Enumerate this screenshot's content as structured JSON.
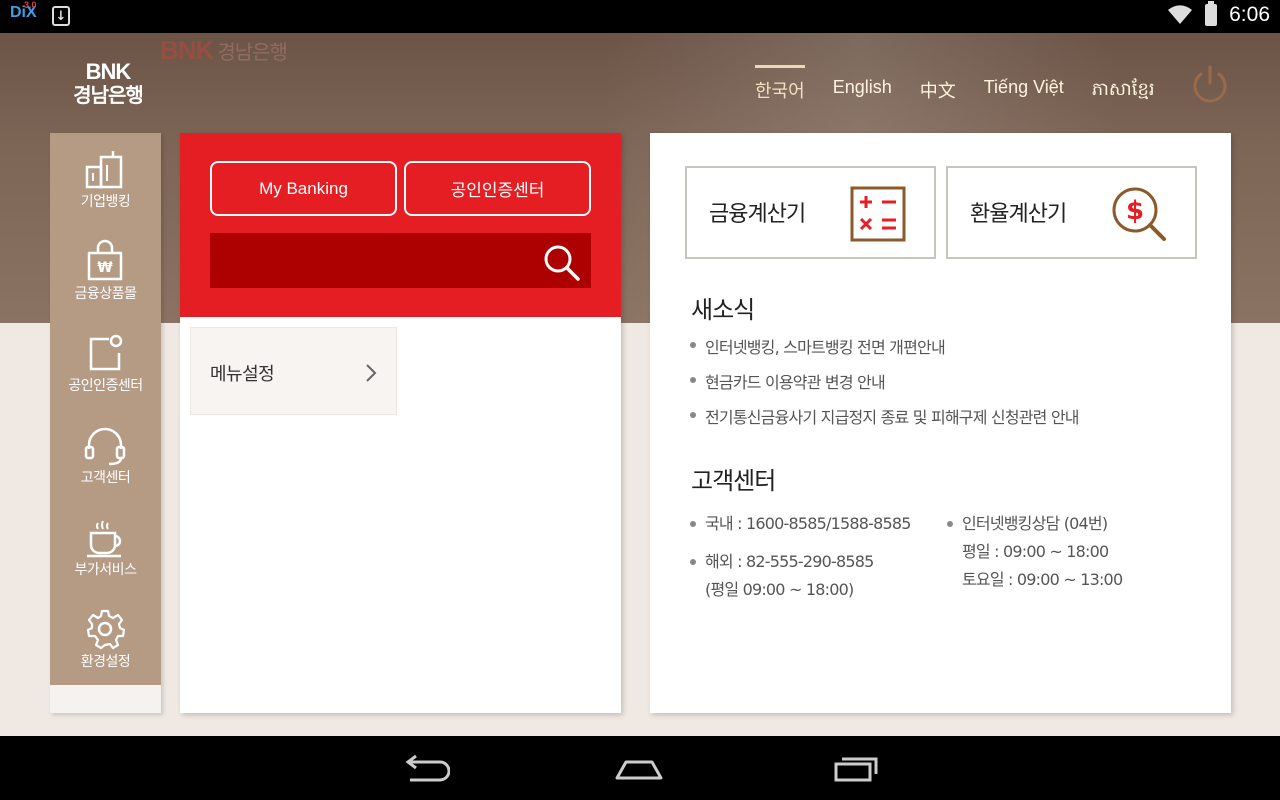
{
  "status_bar": {
    "time": "6:06",
    "left_icons": [
      "dix-icon",
      "download-icon"
    ],
    "dix_label": "DiX",
    "dix_version": "3.0",
    "right_icons": [
      "wifi-icon",
      "battery-icon"
    ]
  },
  "header": {
    "watermark": "BNK",
    "watermark_sub": "경남은행",
    "logo_line1": "BNK",
    "logo_line2": "경남은행",
    "languages": [
      {
        "label": "한국어",
        "active": true
      },
      {
        "label": "English",
        "active": false
      },
      {
        "label": "中文",
        "active": false
      },
      {
        "label": "Tiếng Việt",
        "active": false
      },
      {
        "label": "ភាសាខ្មែរ",
        "active": false
      }
    ],
    "power_icon": "power-icon"
  },
  "sidebar": {
    "items": [
      {
        "label": "기업뱅킹",
        "icon": "building-icon"
      },
      {
        "label": "금융상품몰",
        "icon": "shopping-bag-won-icon"
      },
      {
        "label": "공인인증센터",
        "icon": "certificate-icon"
      },
      {
        "label": "고객센터",
        "icon": "headset-icon"
      },
      {
        "label": "부가서비스",
        "icon": "coffee-cup-icon"
      },
      {
        "label": "환경설정",
        "icon": "gear-icon"
      }
    ]
  },
  "center": {
    "my_banking": "My Banking",
    "cert_center": "공인인증센터",
    "search_icon": "search-icon",
    "menu_settings": "메뉴설정"
  },
  "right": {
    "calc_finance": "금융계산기",
    "calc_exchange": "환율계산기",
    "news_title": "새소식",
    "news": [
      "인터넷뱅킹, 스마트뱅킹 전면 개편안내",
      "현금카드 이용약관 변경 안내",
      "전기통신금융사기 지급정지 종료 및 피해구제 신청관련 안내"
    ],
    "cs_title": "고객센터",
    "cs_domestic": "국내 : 1600-8585/1588-8585",
    "cs_overseas": "해외 : 82-555-290-8585",
    "cs_overseas_hours": "(평일 09:00 ~ 18:00)",
    "cs_internet": "인터넷뱅킹상담 (04번)",
    "cs_weekday": "평일 : 09:00 ~ 18:00",
    "cs_saturday": "토요일 : 09:00 ~ 13:00"
  },
  "colors": {
    "brand_red": "#e51e23",
    "search_dark_red": "#ad0000",
    "sidebar_tan": "#b59a84",
    "icon_brown": "#8b5a2b"
  },
  "nav_bar": {
    "buttons": [
      "back-icon",
      "home-icon",
      "recent-apps-icon"
    ]
  }
}
